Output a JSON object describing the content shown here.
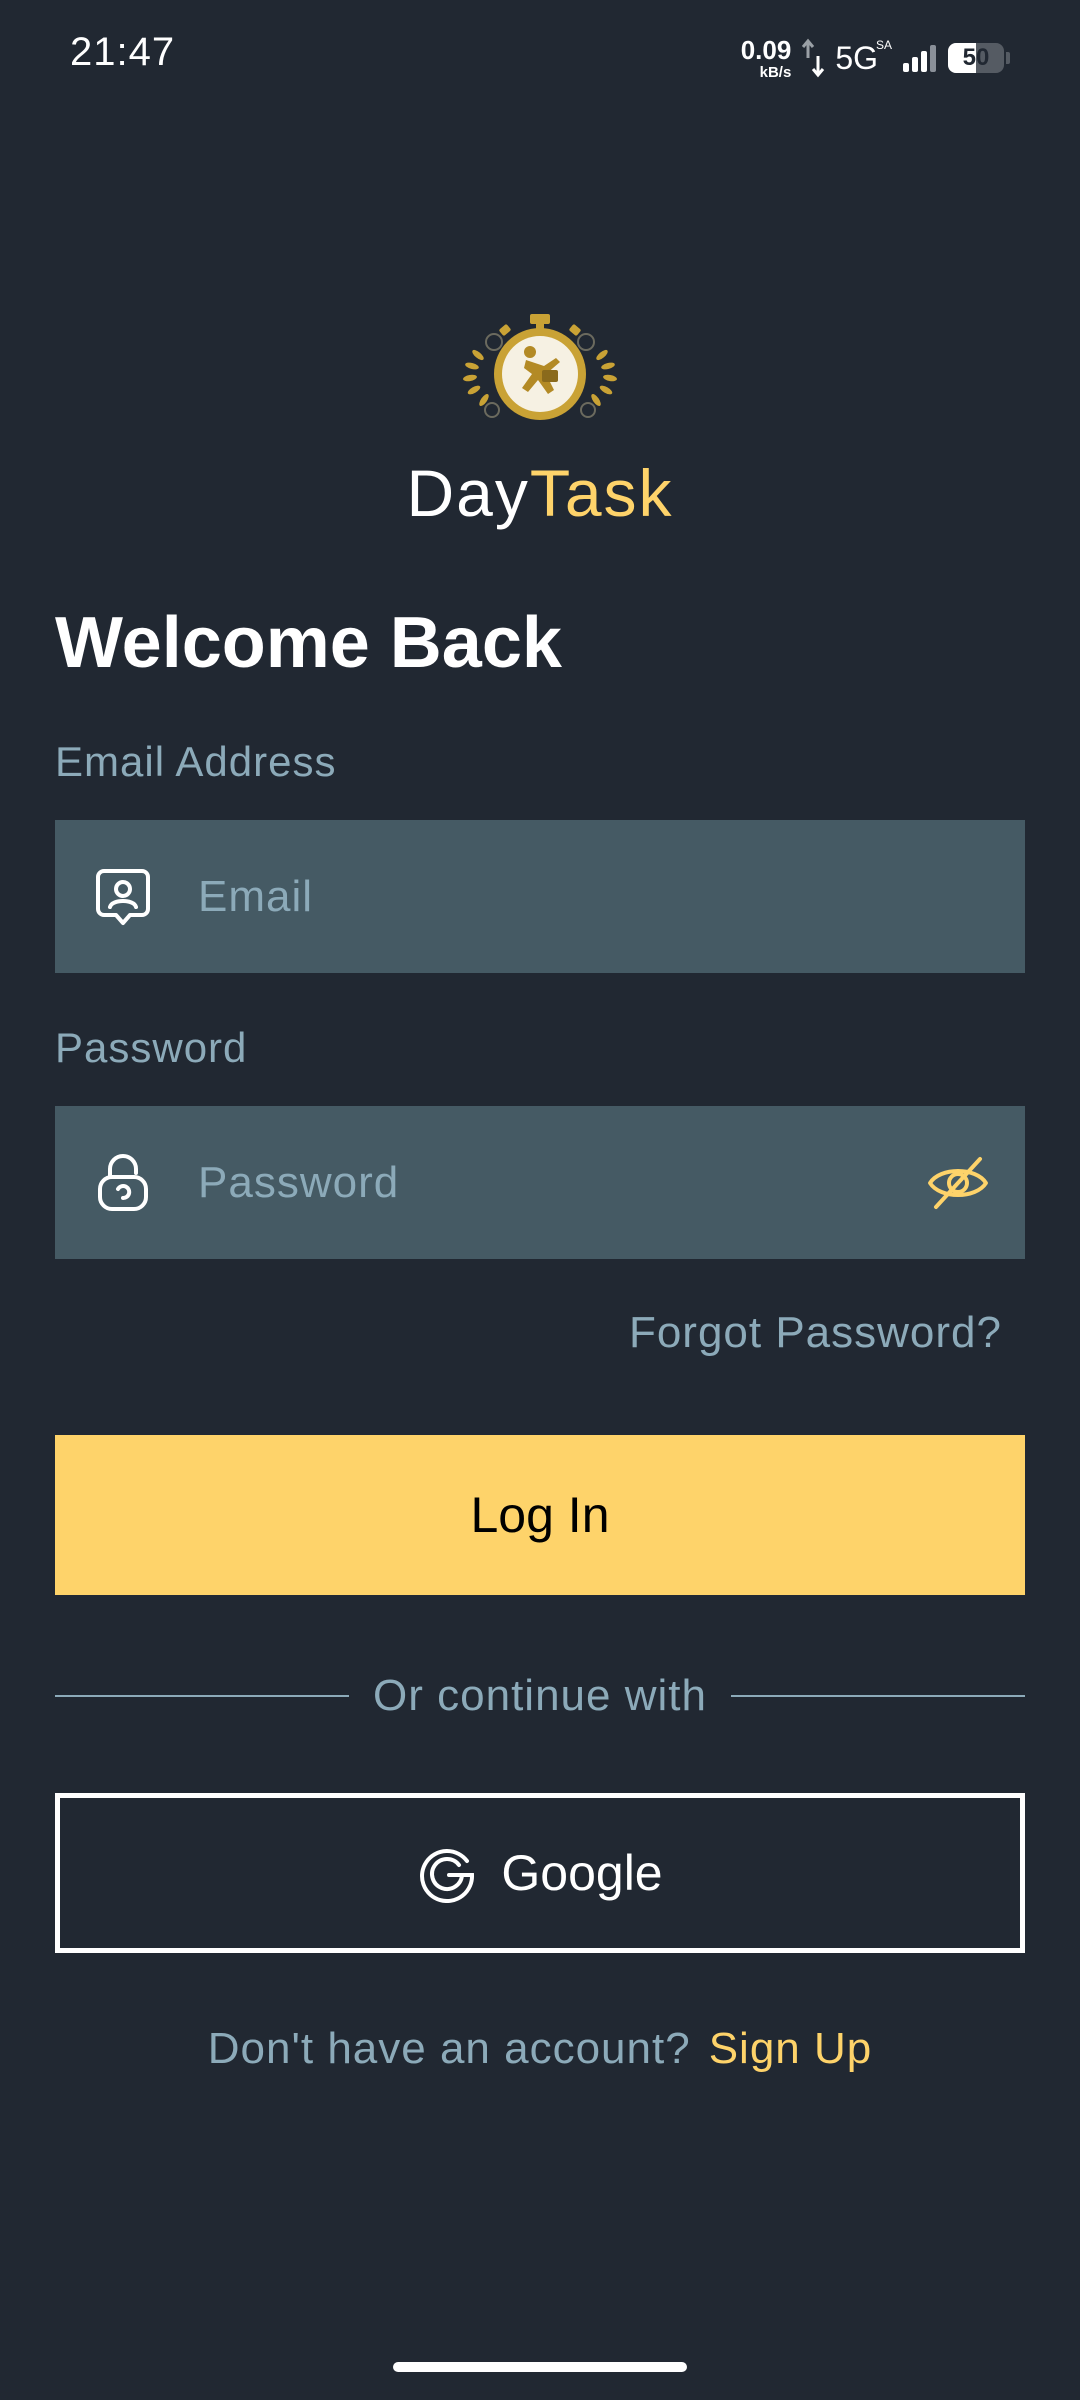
{
  "status_bar": {
    "time": "21:47",
    "net_speed": "0.09",
    "net_speed_unit": "kB/s",
    "network": "5G",
    "network_sup": "SA",
    "battery": "50",
    "battery_level": 0.5
  },
  "brand": {
    "name_part1": "Day",
    "name_part2": "Task",
    "accent_color": "#FED36A"
  },
  "login": {
    "heading": "Welcome Back",
    "email_label": "Email Address",
    "email_placeholder": "Email",
    "password_label": "Password",
    "password_placeholder": "Password",
    "forgot_password": "Forgot Password?",
    "login_button": "Log In",
    "divider_text": "Or continue with",
    "google_button": "Google",
    "signup_prompt": "Don't have an account?",
    "signup_link": "Sign Up"
  },
  "icons": {
    "email": "user-card-icon",
    "password": "lock-icon",
    "toggle_visibility": "eye-off-icon",
    "google": "google-icon",
    "logo": "stopwatch-logo-icon"
  },
  "colors": {
    "background": "#212832",
    "input_background": "#455A64",
    "muted_text": "#8CAAB9",
    "accent": "#FED36A"
  }
}
